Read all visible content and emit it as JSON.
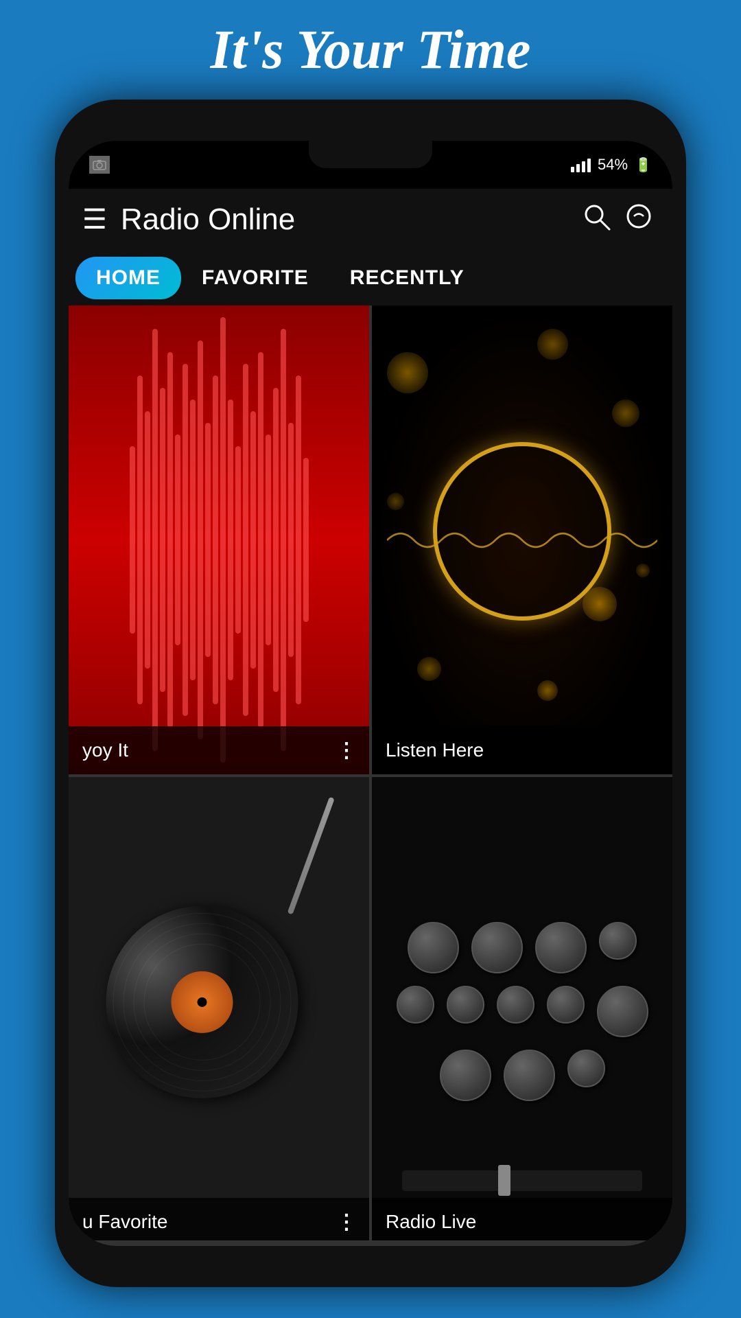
{
  "tagline": "It's Your Time",
  "app": {
    "title": "Radio Online",
    "status_bar": {
      "battery": "54%",
      "signal": "4 bars"
    },
    "tabs": [
      {
        "id": "home",
        "label": "HOME",
        "active": true
      },
      {
        "id": "favorite",
        "label": "FAVORITE",
        "active": false
      },
      {
        "id": "recently",
        "label": "RECENTLY",
        "active": false
      }
    ],
    "grid_items": [
      {
        "id": "item1",
        "label": "yoy It",
        "has_more": true,
        "type": "red_waveform"
      },
      {
        "id": "item2",
        "label": "Listen Here",
        "has_more": false,
        "type": "gold_bokeh"
      },
      {
        "id": "item3",
        "label": "u Favorite",
        "has_more": true,
        "type": "vinyl"
      },
      {
        "id": "item4",
        "label": "Radio Live",
        "has_more": false,
        "type": "mixer"
      }
    ]
  },
  "icons": {
    "hamburger": "☰",
    "search": "⌕",
    "more_vert": "⋮"
  }
}
